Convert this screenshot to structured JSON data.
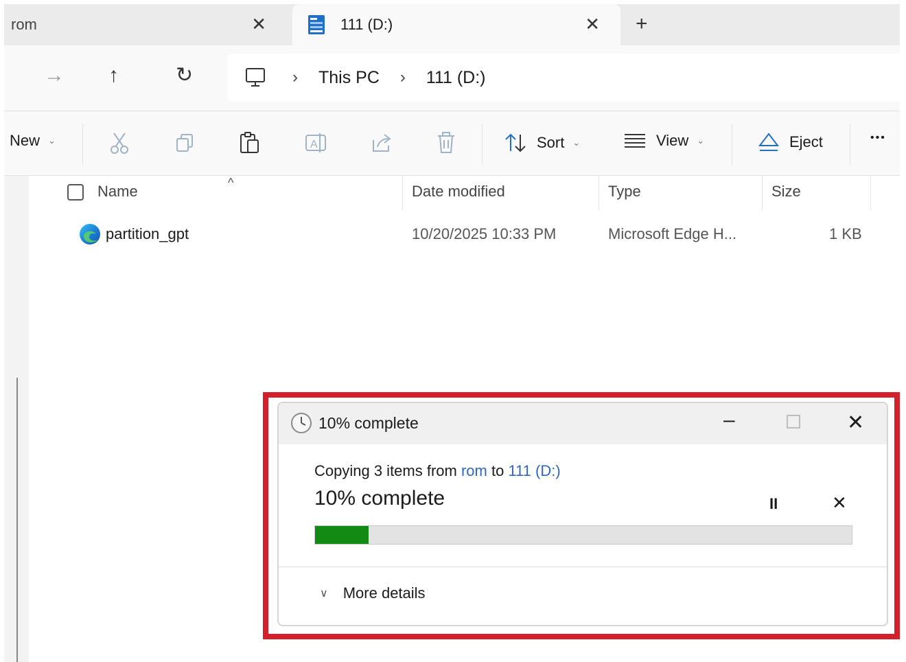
{
  "tabs": [
    {
      "label": "rom",
      "active": false
    },
    {
      "label": "111 (D:)",
      "active": true
    }
  ],
  "tab_close_glyph": "✕",
  "new_tab_glyph": "+",
  "address": {
    "back_icon": "arrow-right-icon",
    "up_icon": "arrow-up-icon",
    "refresh_icon": "refresh-icon",
    "crumbs": [
      "This PC",
      "111 (D:)"
    ],
    "separator": "›"
  },
  "toolbar": {
    "new_label": "New",
    "sort_label": "Sort",
    "view_label": "View",
    "eject_label": "Eject",
    "more_label": "•••"
  },
  "columns": [
    "Name",
    "Date modified",
    "Type",
    "Size"
  ],
  "files": [
    {
      "name": "partition_gpt",
      "date": "10/20/2025 10:33 PM",
      "type": "Microsoft Edge H...",
      "size": "1 KB"
    }
  ],
  "dialog": {
    "title": "10% complete",
    "line_prefix": "Copying 3 items from ",
    "source": "rom",
    "line_mid": " to ",
    "destination": "111 (D:)",
    "big_status": "10% complete",
    "progress": 0.1,
    "pause_glyph": "II",
    "cancel_glyph": "✕",
    "more_details": "More details",
    "accent_color": "#138a13",
    "highlight_color": "#d2202d"
  }
}
